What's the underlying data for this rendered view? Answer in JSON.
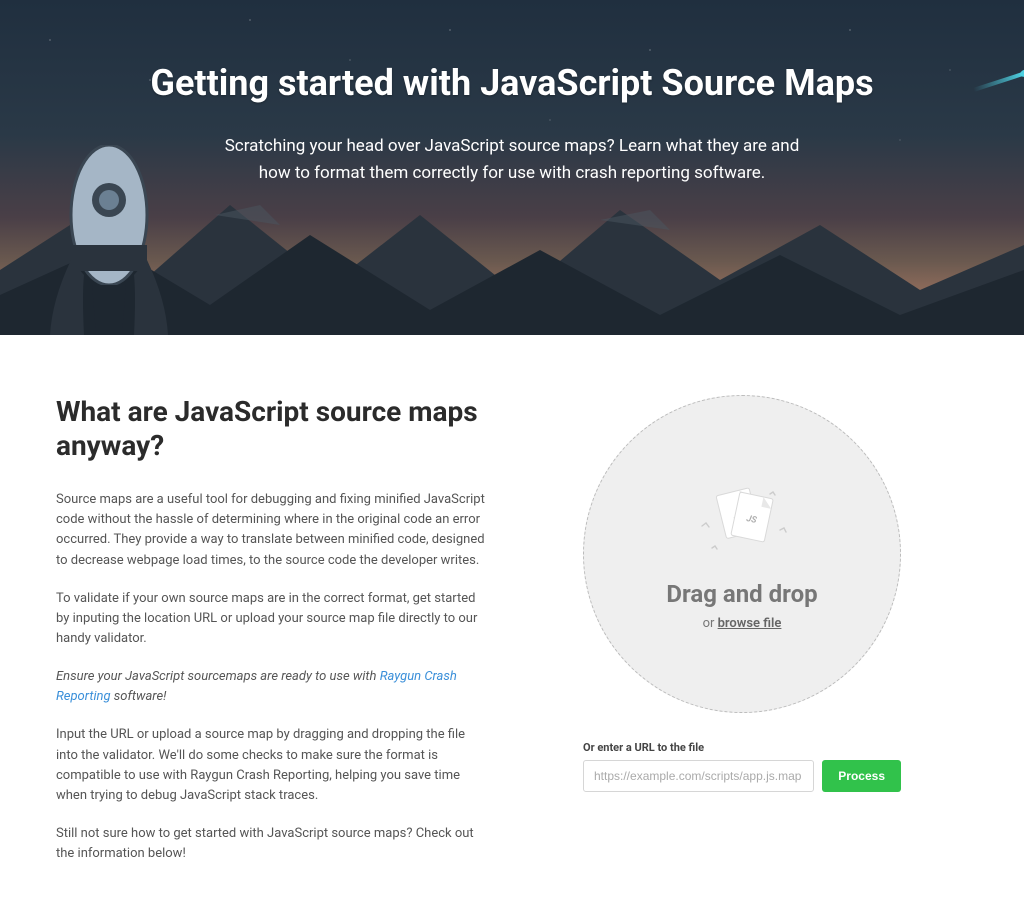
{
  "hero": {
    "title": "Getting started with JavaScript Source Maps",
    "subtitle": "Scratching your head over JavaScript source maps? Learn what they are and how to format them correctly for use with crash reporting software."
  },
  "article": {
    "heading": "What are JavaScript source maps anyway?",
    "p1": "Source maps are a useful tool for debugging and fixing minified JavaScript code without the hassle of determining where in the original code an error occurred. They provide a way to translate between minified code, designed to decrease webpage load times, to the source code the developer writes.",
    "p2": "To validate if your own source maps are in the correct format, get started by inputing the location URL or upload your source map file directly to our handy validator.",
    "p3_prefix": "Ensure your JavaScript sourcemaps are ready to use with ",
    "p3_link": "Raygun Crash Reporting",
    "p3_suffix": " software!",
    "p4": "Input the URL or upload a source map by dragging and dropping the file into the validator. We'll do some checks to make sure the format is compatible to use with Raygun Crash Reporting, helping you save time when trying to debug JavaScript stack traces.",
    "p5": "Still not sure how to get started with JavaScript source maps? Check out the information below!"
  },
  "uploader": {
    "drag_title": "Drag and drop",
    "or_text": "or ",
    "browse_text": "browse file",
    "url_label": "Or enter a URL to the file",
    "url_placeholder": "https://example.com/scripts/app.js.map",
    "process_button": "Process",
    "file_badge": "JS"
  },
  "colors": {
    "accent_green": "#31c24b",
    "link_blue": "#3a8fd9"
  }
}
